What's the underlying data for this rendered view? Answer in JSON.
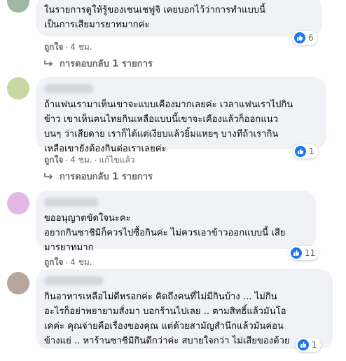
{
  "comments": [
    {
      "text": "ในรายการดูให้รู้ของเชนเชฟูจิ เคยบอกไว้ว่าการทำแบบนี้\nเป็นการเสียมารยาทมากค่ะ",
      "reaction_count": "6",
      "like_label": "ถูกใจ",
      "time": "4 ชม.",
      "replies_label": "การตอบกลับ 1 รายการ"
    },
    {
      "text": "ถ้าแฟนเรามาเห็นเขาจะแบบเคืองมากเลยค่ะ เวลาแฟนเราไปกิน\nข้าว เขาเห็นคนไทยกินเหลือแบบนี้เขาจะเคืองแล้วก็ออกแนว\nบนๆ ว่าเสียดาย เราก็ได้แต่เงียบแล้วยิ้มแหยๆ บางทีถ้าเรากิน\nเหลือเขายังต้องกินต่อเราเลยค่ะ",
      "reaction_count": "1",
      "like_label": "ถูกใจ",
      "time": "4 ชม.",
      "edited_label": "แก้ไขแล้ว",
      "replies_label": "การตอบกลับ 1 รายการ"
    },
    {
      "text": "ขออนุญาตขัดใจนะคะ\nอยากกินซาชิมิก็ควรไปซื้อกินค่ะ ไม่ควรเอาข้าวออกแบบนี้ เสีย\nมารยาทมาก",
      "reaction_count": "11",
      "like_label": "ถูกใจ",
      "time": "4 ชม."
    },
    {
      "text": "กินอาหารเหลือไม่ดีหรอกค่ะ คิดถึงคนที่ไม่มีกินบ้าง ... ไม่กิน\nอะไรก็อย่าพยายามสั่งมา บอกร้านไปเลย .. ตามสิทธิ์แล้วมันโอ\nเคค่ะ คุณจ่ายคือเรื่องของคุณ แต่ด้วยสามัญสำนึกแล้วมันค่อน\nข้างแย่ .. หาร้านซาชิมิกินดีกว่าค่ะ สบายใจกว่า ไม่เสียของด้วย",
      "reaction_count": "1"
    }
  ],
  "colors": {
    "bubble": "#f0f2f5",
    "meta_text": "#65676b",
    "like_blue": "#1877f2"
  },
  "icons": {
    "reaction": "thumbs-up-icon",
    "reply": "reply-arrow-icon"
  }
}
